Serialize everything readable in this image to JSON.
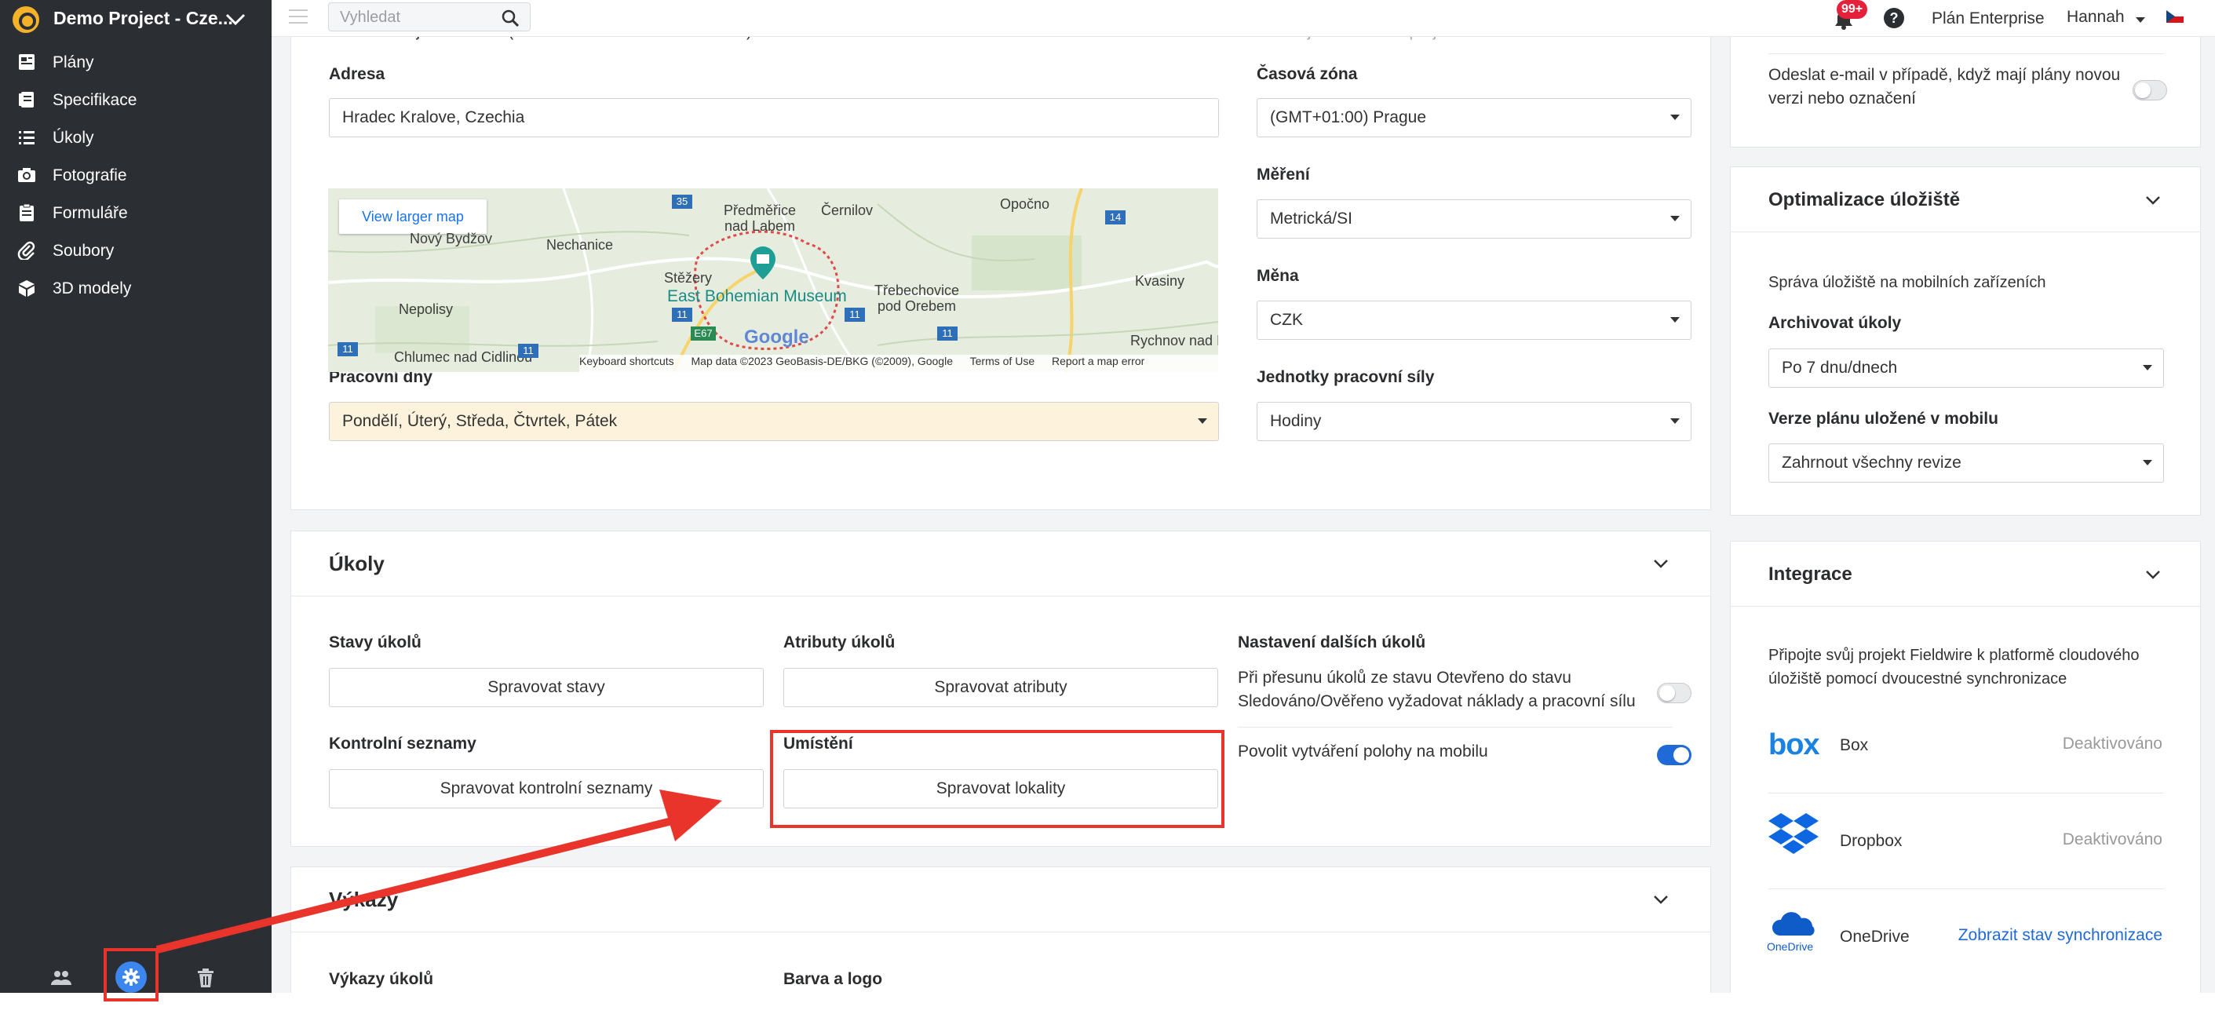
{
  "sidebar": {
    "project_title": "Demo Project - Cze...",
    "items": [
      {
        "icon": "plans-icon",
        "label": "Plány"
      },
      {
        "icon": "specs-icon",
        "label": "Specifikace"
      },
      {
        "icon": "tasks-icon",
        "label": "Úkoly"
      },
      {
        "icon": "camera-icon",
        "label": "Fotografie"
      },
      {
        "icon": "forms-icon",
        "label": "Formuláře"
      },
      {
        "icon": "files-icon",
        "label": "Soubory"
      },
      {
        "icon": "cube-icon",
        "label": "3D modely"
      }
    ],
    "footer_icons": [
      "people-icon",
      "settings-icon",
      "trash-icon"
    ]
  },
  "topbar": {
    "search_placeholder": "Vyhledat",
    "notification_count": "99+",
    "plan": "Plán Enterprise",
    "user": "Hannah"
  },
  "project": {
    "name_value": "Demo Project - Czech (TEMPLATE - DO NOT MODIFY)",
    "code_placeholder": "Zadejte kód svého projektu",
    "address_label": "Adresa",
    "address_value": "Hradec Kralove, Czechia",
    "timezone_label": "Časová zóna",
    "timezone_value": "(GMT+01:00) Prague",
    "measure_label": "Měření",
    "measure_value": "Metrická/SI",
    "currency_label": "Měna",
    "currency_value": "CZK",
    "workdays_label": "Pracovní dny",
    "workdays_value": "Pondělí, Úterý, Středa, Čtvrtek, Pátek",
    "labor_label": "Jednotky pracovní síly",
    "labor_value": "Hodiny"
  },
  "map": {
    "larger_map": "View larger map",
    "places": [
      "Předměřice nad Labem",
      "Černilov",
      "Opočno",
      "Nový Bydžov",
      "Nechanice",
      "Stěžery",
      "East Bohemian Museum",
      "Třebechovice pod Orebem",
      "Kvasiny",
      "Nepolisy",
      "Chlumec nad Cidlinou",
      "Rychnov nad Kněžnou"
    ],
    "roads": [
      "35",
      "14",
      "11",
      "11",
      "11",
      "E67",
      "11",
      "11"
    ],
    "brand": "Google",
    "footer": [
      "Keyboard shortcuts",
      "Map data ©2023 GeoBasis-DE/BKG (©2009), Google",
      "Terms of Use",
      "Report a map error"
    ]
  },
  "tasks": {
    "title": "Úkoly",
    "statuses_label": "Stavy úkolů",
    "statuses_button": "Spravovat stavy",
    "attributes_label": "Atributy úkolů",
    "attributes_button": "Spravovat atributy",
    "checklists_label": "Kontrolní seznamy",
    "checklists_button": "Spravovat kontrolní seznamy",
    "locations_label": "Umístění",
    "locations_button": "Spravovat lokality",
    "other_label": "Nastavení dalších úkolů",
    "other_setting_1": "Při přesunu úkolů ze stavu Otevřeno do stavu Sledováno/Ověřeno vyžadovat náklady a pracovní sílu",
    "other_setting_1_on": false,
    "other_setting_2": "Povolit vytváření polohy na mobilu",
    "other_setting_2_on": true
  },
  "reports": {
    "title": "Výkazy",
    "task_reports_label": "Výkazy úkolů",
    "color_logo_label": "Barva a logo"
  },
  "right": {
    "email_setting": "Odeslat e-mail v případě, když mají plány novou verzi nebo označení",
    "email_setting_on": false,
    "storage": {
      "title": "Optimalizace úložiště",
      "subtitle": "Správa úložiště na mobilních zařízeních",
      "archive_label": "Archivovat úkoly",
      "archive_value": "Po 7 dnu/dnech",
      "version_label": "Verze plánu uložené v mobilu",
      "version_value": "Zahrnout všechny revize"
    },
    "integrations": {
      "title": "Integrace",
      "description": "Připojte svůj projekt Fieldwire k platformě cloudového úložiště pomocí dvoucestné synchronizace",
      "items": [
        {
          "logo": "box",
          "name": "Box",
          "status": "Deaktivováno"
        },
        {
          "logo": "dropbox",
          "name": "Dropbox",
          "status": "Deaktivováno"
        },
        {
          "logo": "OneDrive",
          "name": "OneDrive",
          "status": "Zobrazit stav synchronizace"
        }
      ]
    }
  },
  "colors": {
    "annotation_red": "#e8342a",
    "link_blue": "#1f6ad6",
    "sidebar": "#2b2e33",
    "highlight_field": "#fdf3dc"
  }
}
